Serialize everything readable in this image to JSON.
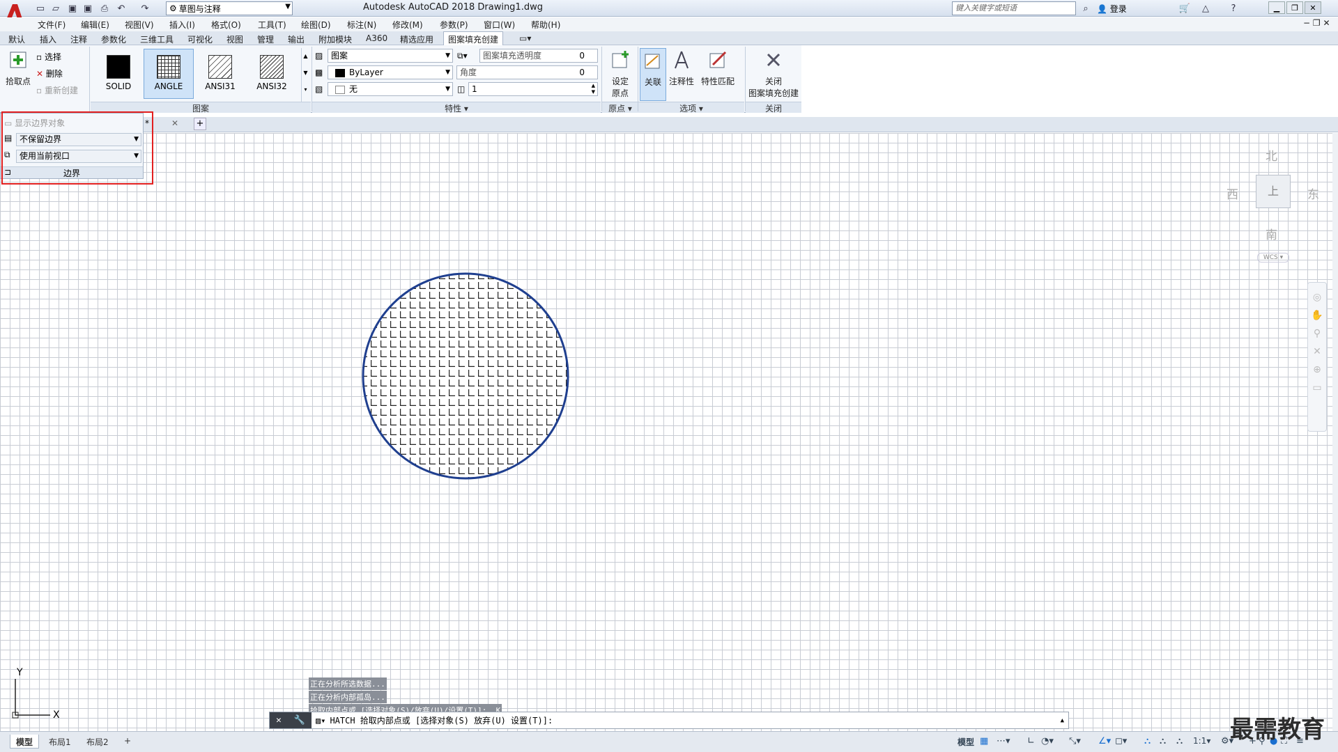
{
  "title": "Autodesk AutoCAD 2018    Drawing1.dwg",
  "workspace": "草图与注释",
  "search_placeholder": "键入关键字或短语",
  "login": "登录",
  "menus": [
    "文件(F)",
    "编辑(E)",
    "视图(V)",
    "插入(I)",
    "格式(O)",
    "工具(T)",
    "绘图(D)",
    "标注(N)",
    "修改(M)",
    "参数(P)",
    "窗口(W)",
    "帮助(H)"
  ],
  "ribbon_tabs": [
    "默认",
    "插入",
    "注释",
    "参数化",
    "三维工具",
    "可视化",
    "视图",
    "管理",
    "输出",
    "附加模块",
    "A360",
    "精选应用",
    "图案填充创建"
  ],
  "active_tab": "图案填充创建",
  "boundary": {
    "pick_points": "拾取点",
    "select": "选择",
    "remove": "删除",
    "recreate": "重新创建",
    "show_objects": "显示边界对象",
    "retain": "不保留边界",
    "viewport": "使用当前视口",
    "label": "边界"
  },
  "patterns": {
    "items": [
      "SOLID",
      "ANGLE",
      "ANSI31",
      "ANSI32"
    ],
    "selected": "ANGLE",
    "label": "图案"
  },
  "properties": {
    "type": "图案",
    "color": "ByLayer",
    "background": "无",
    "transparency_label": "图案填充透明度",
    "transparency": "0",
    "angle_label": "角度",
    "angle": "0",
    "scale": "1",
    "label": "特性"
  },
  "origin": {
    "set": "设定",
    "set2": "原点",
    "label": "原点"
  },
  "options": {
    "associative": "关联",
    "annotative": "注释性",
    "match": "特性匹配",
    "label": "选项"
  },
  "close": {
    "btn1": "关闭",
    "btn2": "图案填充创建",
    "label": "关闭"
  },
  "viewcube": {
    "north": "北",
    "south": "南",
    "east": "东",
    "west": "西",
    "top": "上",
    "wcs": "WCS"
  },
  "ucs": {
    "x": "X",
    "y": "Y"
  },
  "history": [
    "正在分析所选数据...",
    "正在分析内部孤岛...",
    "拾取内部点或 [选择对象(S)/放弃(U)/设置(T)]: _K"
  ],
  "command": "HATCH 拾取内部点或 [选择对象(S) 放弃(U) 设置(T)]:",
  "layout_tabs": [
    "模型",
    "布局1",
    "布局2"
  ],
  "status": {
    "model": "模型",
    "scale": "1:1"
  },
  "watermark": "最需教育",
  "colors": {
    "circle": "#1f3f8f",
    "highlight": "#e21f1f",
    "grid": "#c8ccd4"
  }
}
